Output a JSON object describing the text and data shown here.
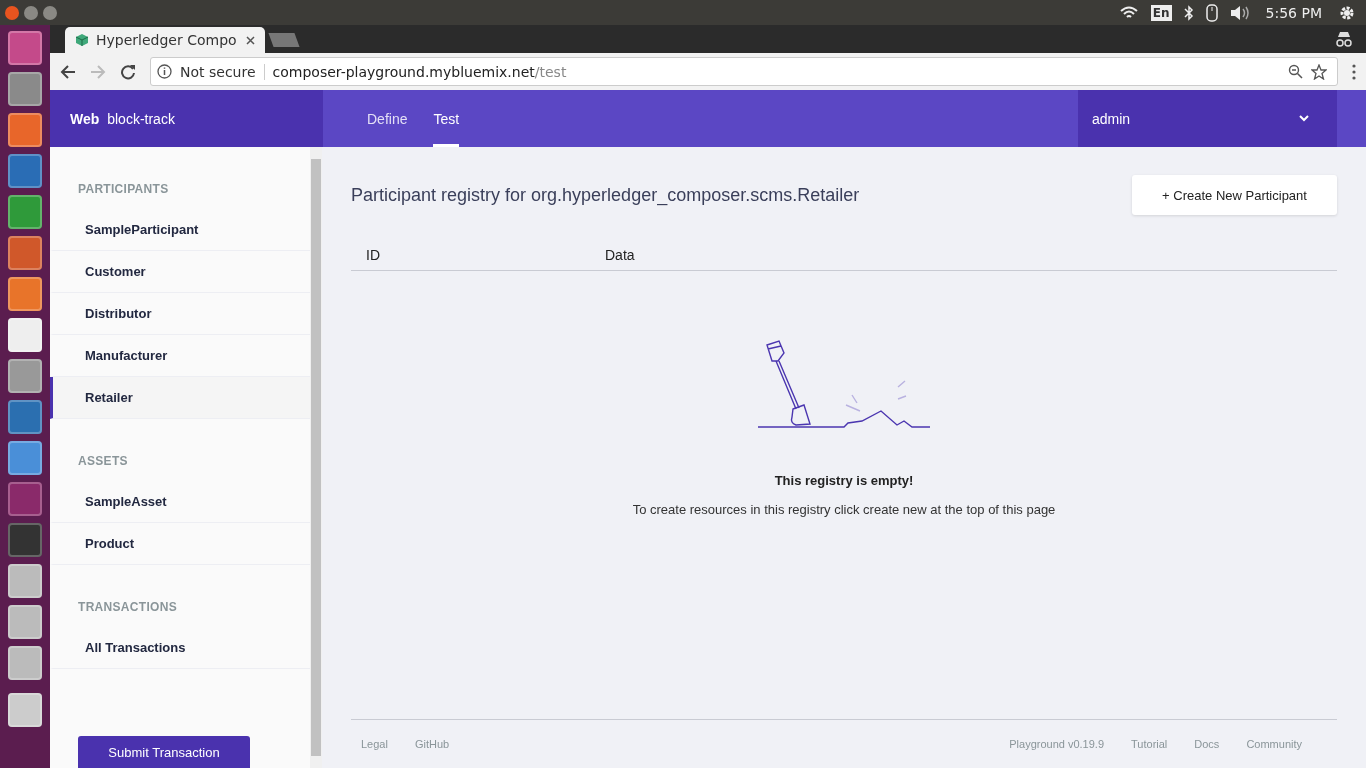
{
  "system_bar": {
    "language": "En",
    "time": "5:56 PM"
  },
  "browser": {
    "tabs": [
      {
        "title": "Hyperledger Compo",
        "selected": true
      }
    ],
    "security": "Not secure",
    "url_host": "composer-playground.mybluemix.net",
    "url_path": "/test"
  },
  "header": {
    "brand_bold": "Web",
    "brand": "block-track",
    "nav": [
      {
        "label": "Define",
        "selected": false
      },
      {
        "label": "Test",
        "selected": true
      }
    ],
    "user": "admin"
  },
  "sidebar": {
    "sections": [
      {
        "heading": "PARTICIPANTS",
        "items": [
          {
            "label": "SampleParticipant",
            "selected": false
          },
          {
            "label": "Customer",
            "selected": false
          },
          {
            "label": "Distributor",
            "selected": false
          },
          {
            "label": "Manufacturer",
            "selected": false
          },
          {
            "label": "Retailer",
            "selected": true
          }
        ]
      },
      {
        "heading": "ASSETS",
        "items": [
          {
            "label": "SampleAsset",
            "selected": false
          },
          {
            "label": "Product",
            "selected": false
          }
        ]
      },
      {
        "heading": "TRANSACTIONS",
        "items": [
          {
            "label": "All Transactions",
            "selected": false
          }
        ]
      }
    ],
    "submit_button": "Submit Transaction"
  },
  "main": {
    "title": "Participant registry for org.hyperledger_composer.scms.Retailer",
    "create_button": "+ Create New Participant",
    "columns": [
      "ID",
      "Data"
    ],
    "empty_title": "This registry is empty!",
    "empty_message": "To create resources in this registry click create new at the top of this page"
  },
  "footer": {
    "left_links": [
      "Legal",
      "GitHub"
    ],
    "version": "Playground v0.19.9",
    "right_links": [
      "Tutorial",
      "Docs",
      "Community"
    ]
  }
}
